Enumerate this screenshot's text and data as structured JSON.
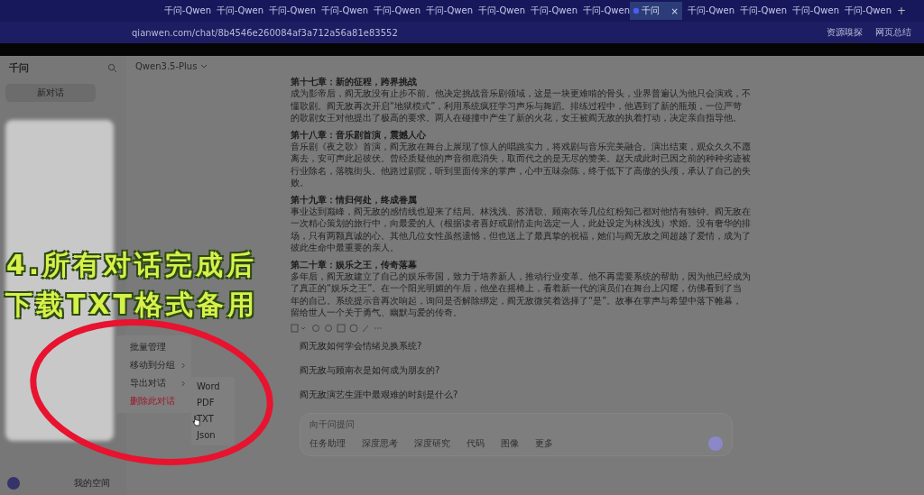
{
  "browser": {
    "tabs": [
      {
        "label": "千问-Qwen",
        "selected": false
      },
      {
        "label": "千问-Qwen",
        "selected": false
      },
      {
        "label": "千问-Qwen",
        "selected": false
      },
      {
        "label": "千问-Qwen",
        "selected": false
      },
      {
        "label": "千问-Qwen",
        "selected": false
      },
      {
        "label": "千问-Qwen",
        "selected": false
      },
      {
        "label": "千问-Qwen",
        "selected": false
      },
      {
        "label": "千问-Qwen",
        "selected": false
      },
      {
        "label": "千问-Qwen",
        "selected": false
      },
      {
        "label": "千问",
        "selected": true
      },
      {
        "label": "千问-Qwen",
        "selected": false
      },
      {
        "label": "千问-Qwen",
        "selected": false
      },
      {
        "label": "千问-Qwen",
        "selected": false
      },
      {
        "label": "千问-Qwen",
        "selected": false
      }
    ],
    "new_tab": "+",
    "close_tab": "×",
    "url": "qianwen.com/chat/8b4546e260084af3a712a56a81e83552",
    "toolbar_links": [
      "资源嗅探",
      "网页总结"
    ]
  },
  "sidebar": {
    "logo": "千问",
    "new_chat": "新对话",
    "my_space": "我的空间"
  },
  "header": {
    "model": "Qwen3.5-Plus"
  },
  "chapters": [
    {
      "title": "第十七章：新的征程，跨界挑战",
      "body": "成为影帝后，阎无敌没有止步不前。他决定挑战音乐剧领域，这是一块更难啃的骨头，业界普遍认为他只会演戏，不懂歌剧。阎无敌再次开启“地狱模式”，利用系统疯狂学习声乐与舞蹈。排练过程中，他遇到了新的瓶颈，一位严苛的歌剧女王对他提出了极高的要求。两人在碰撞中产生了新的火花，女王被阎无敌的执着打动，决定亲自指导他。"
    },
    {
      "title": "第十八章：音乐剧首演，震撼人心",
      "body": "音乐剧《夜之歌》首演，阎无敌在舞台上展现了惊人的唱跳实力，将戏剧与音乐完美融合。演出结束，观众久久不愿离去，安可声此起彼伏。曾经质疑他的声音彻底消失，取而代之的是无尽的赞美。赵天成此时已因之前的种种劣迹被行业除名，落魄街头。他路过剧院，听到里面传来的掌声，心中五味杂陈，终于低下了高傲的头颅，承认了自己的失败。"
    },
    {
      "title": "第十九章：情归何处，终成眷属",
      "body": "事业达到巅峰，阎无敌的感情线也迎来了结局。林浅浅、苏清歌、顾南衣等几位红粉知己都对他情有独钟。阎无敌在一次精心策划的旅行中，向最爱的人（根据读者喜好或剧情走向选定一人，此处设定为林浅浅）求婚。没有奢华的排场，只有两颗真诚的心。其他几位女性虽然遗憾，但也送上了最真挚的祝福，她们与阎无敌之间超越了爱情，成为了彼此生命中最重要的亲人。"
    },
    {
      "title": "第二十章：娱乐之王，传奇落幕",
      "body": "多年后，阎无敌建立了自己的娱乐帝国，致力于培养新人，推动行业变革。他不再需要系统的帮助，因为他已经成为了真正的“娱乐之王”。在一个阳光明媚的午后，他坐在摇椅上，看着新一代的演员们在舞台上闪耀，仿佛看到了当年的自己。系统提示音再次响起，询问是否解除绑定，阎无敌微笑着选择了“是”。故事在掌声与希望中落下帷幕，留给世人一个关于勇气、幽默与爱的传奇。"
    }
  ],
  "suggestions": [
    "阎无敌如何学会情绪兑换系统?",
    "阎无敌与顾南衣是如何成为朋友的?",
    "阎无敌演艺生涯中最艰难的时刻是什么?"
  ],
  "composer": {
    "placeholder": "向千问提问",
    "tools": [
      "任务助理",
      "深度思考",
      "深度研究",
      "代码",
      "图像",
      "更多"
    ]
  },
  "context_menu": {
    "items": [
      {
        "label": "批量管理",
        "kind": "plain",
        "danger": false
      },
      {
        "label": "移动到分组",
        "kind": "submenu",
        "danger": false
      },
      {
        "label": "导出对话",
        "kind": "submenu",
        "danger": false
      },
      {
        "label": "删除此对话",
        "kind": "plain",
        "danger": true
      }
    ],
    "submenu": [
      "Word",
      "PDF",
      "TXT",
      "Json"
    ]
  },
  "caption": [
    "4.所有对话完成后",
    "下载TXT格式备用"
  ]
}
